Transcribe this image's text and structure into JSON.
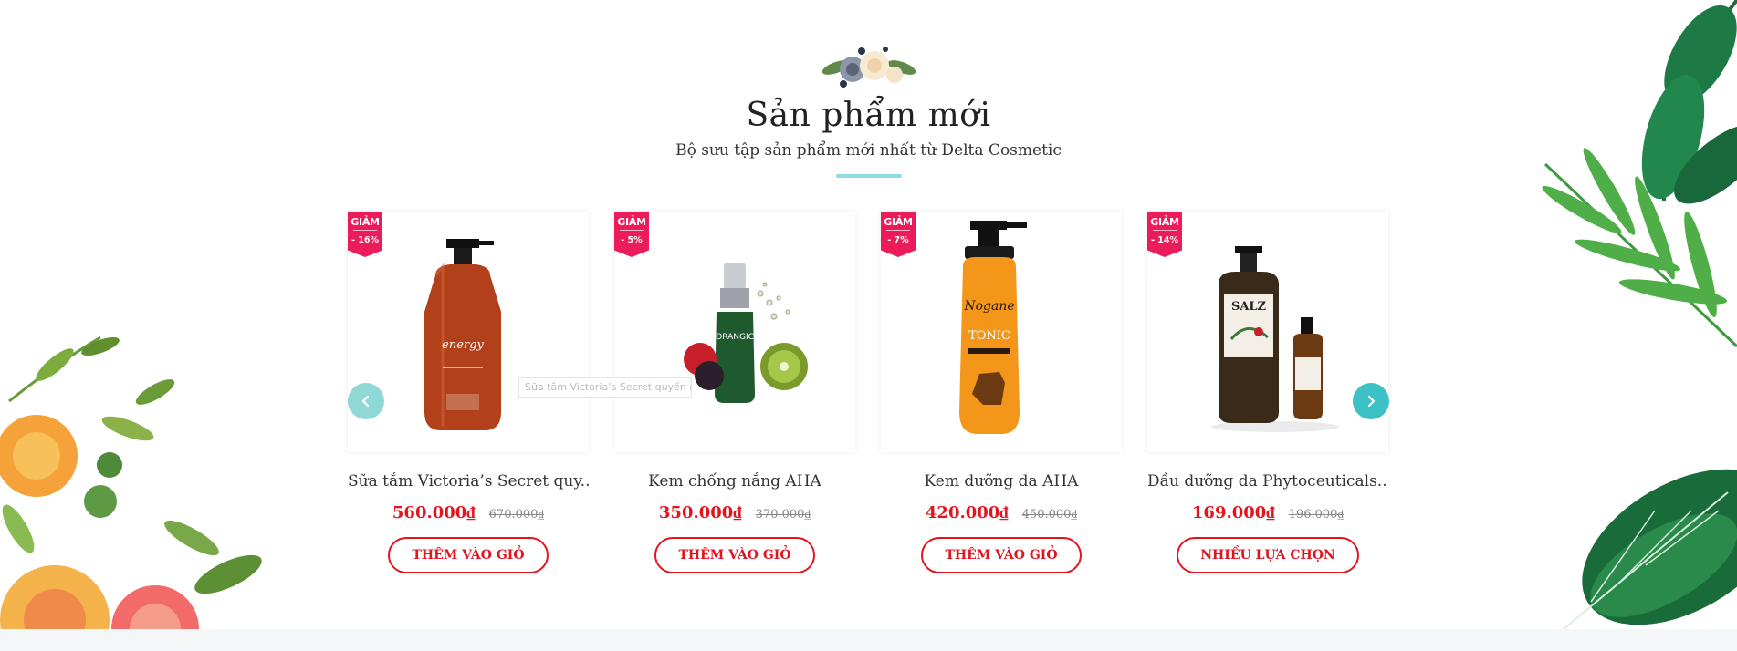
{
  "section": {
    "title": "Sản phẩm mới",
    "subtitle": "Bộ sưu tập sản phẩm mới nhất từ Delta Cosmetic"
  },
  "colors": {
    "accent_teal": "#8fdbe0",
    "price_red": "#e3141e",
    "badge_pink": "#ec1c5b",
    "arrow_teal": "#3cc2c6"
  },
  "products": [
    {
      "name": "Sữa tắm Victoria’s Secret quy...",
      "badge_label": "GIẢM",
      "discount": "- 16%",
      "price": "560.000₫",
      "old_price": "670.000₫",
      "button": "THÊM VÀO GIỎ"
    },
    {
      "name": "Kem chống nắng AHA",
      "badge_label": "GIẢM",
      "discount": "- 5%",
      "price": "350.000₫",
      "old_price": "370.000₫",
      "button": "THÊM VÀO GIỎ"
    },
    {
      "name": "Kem dưỡng da AHA",
      "badge_label": "GIẢM",
      "discount": "- 7%",
      "price": "420.000₫",
      "old_price": "450.000₫",
      "button": "THÊM VÀO GIỎ"
    },
    {
      "name": "Dầu dưỡng da Phytoceuticals...",
      "badge_label": "GIẢM",
      "discount": "- 14%",
      "price": "169.000₫",
      "old_price": "196.000₫",
      "button": "NHIỀU LỰA CHỌN"
    }
  ],
  "tooltip": "Sữa tắm Victoria’s Secret quyến rũ",
  "product_labels": {
    "p1": "energy",
    "p2": "ORANGIC",
    "p3": "TONIC",
    "p4": "SALZ"
  },
  "icons": {
    "prev": "chevron-left-icon",
    "next": "chevron-right-icon"
  }
}
